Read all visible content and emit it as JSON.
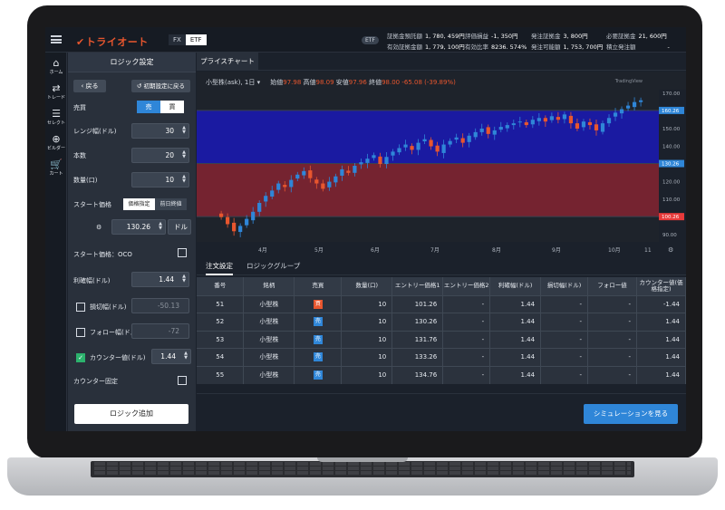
{
  "header": {
    "logo": "トライオート",
    "mode_tabs": [
      "FX",
      "ETF"
    ],
    "active_mode": "ETF",
    "etf_pill": "ETF",
    "account": [
      {
        "label": "証拠金預託額",
        "value": "1, 780, 459円"
      },
      {
        "label": "評価損益",
        "value": "-1, 350円"
      },
      {
        "label": "発注証拠金",
        "value": "3, 800円"
      },
      {
        "label": "必要証拠金",
        "value": "21, 600円"
      },
      {
        "label": "有効証拠金額",
        "value": "1, 779, 100円"
      },
      {
        "label": "有効比率",
        "value": "8236. 574%"
      },
      {
        "label": "発注可能額",
        "value": "1, 753, 700円"
      },
      {
        "label": "積立発注額",
        "value": "-"
      }
    ]
  },
  "nav": [
    {
      "icon": "home-icon",
      "label": "ホーム"
    },
    {
      "icon": "trade-icon",
      "label": "トレード"
    },
    {
      "icon": "select-icon",
      "label": "セレクト"
    },
    {
      "icon": "builder-icon",
      "label": "ビルダー"
    },
    {
      "icon": "cart-icon",
      "label": "カート"
    }
  ],
  "logic": {
    "title": "ロジック設定",
    "back": "戻る",
    "reset": "初期設定に戻る",
    "side_label": "売買",
    "side_options": [
      "売",
      "買"
    ],
    "range_label": "レンジ幅(ドル)",
    "range_value": "30",
    "count_label": "本数",
    "count_value": "20",
    "qty_label": "数量(口)",
    "qty_value": "10",
    "start_label": "スタート価格",
    "start_options": [
      "価格指定",
      "前日終値"
    ],
    "start_value": "130.26",
    "start_unit": "ドル",
    "oco_label": "スタート価格：OCO",
    "tp_label": "利確幅(ドル)",
    "tp_value": "1.44",
    "sl_label": "損切幅(ドル)",
    "sl_value": "-50.13",
    "follow_label": "フォロー幅(ドル)",
    "follow_value": "-72",
    "counter_label": "カウンター値(ドル)",
    "counter_value": "1.44",
    "counter_fixed_label": "カウンター固定",
    "add_button": "ロジック追加"
  },
  "chart_tab": "プライスチャート",
  "chart_info": {
    "symbol": "小型株(ask), 1日",
    "open_label": "始値",
    "open": "97.98",
    "high_label": "高値",
    "high": "98.09",
    "low_label": "安値",
    "low": "97.96",
    "close_label": "終値",
    "close": "98.00",
    "change": "-65.08 (-39.89%)",
    "watermark": "TradingView"
  },
  "chart_data": {
    "type": "candlestick",
    "x_ticks": [
      "4月",
      "5月",
      "6月",
      "7月",
      "8月",
      "9月",
      "10月",
      "11"
    ],
    "y_ticks": [
      170.0,
      160.0,
      150.0,
      140.0,
      130.0,
      120.0,
      110.0,
      100.0,
      90.0
    ],
    "ylim": [
      86,
      172
    ],
    "price_labels": [
      {
        "value": "160.26",
        "color": "#2f86d8"
      },
      {
        "value": "130.26",
        "color": "#2f86d8"
      },
      {
        "value": "100.26",
        "color": "#e83a3a"
      }
    ],
    "zones": [
      {
        "from": 130.26,
        "to": 160.26,
        "color": "#1a1aa8"
      },
      {
        "from": 100.26,
        "to": 130.26,
        "color": "#7a2430"
      }
    ],
    "close_series": [
      100,
      96,
      92,
      95,
      99,
      103,
      108,
      112,
      115,
      119,
      117,
      121,
      124,
      126,
      122,
      119,
      116,
      120,
      123,
      127,
      125,
      129,
      131,
      133,
      135,
      130,
      134,
      137,
      139,
      141,
      138,
      142,
      144,
      140,
      137,
      141,
      143,
      145,
      142,
      146,
      148,
      150,
      147,
      149,
      151,
      152,
      153,
      154,
      152,
      155,
      156,
      154,
      157,
      155,
      158,
      153,
      150,
      154,
      152,
      149,
      153,
      156,
      159,
      161,
      163,
      165,
      166
    ]
  },
  "orders": {
    "tabs": [
      "注文設定",
      "ロジックグループ"
    ],
    "columns": [
      "番号",
      "銘柄",
      "売買",
      "数量(口)",
      "エントリー価格1",
      "エントリー価格2",
      "利確幅(ドル)",
      "損切幅(ドル)",
      "フォロー値",
      "カウンター値(価格指定)"
    ],
    "rows": [
      {
        "no": "51",
        "name": "小型株",
        "side": "買",
        "qty": "10",
        "e1": "101.26",
        "e2": "-",
        "tp": "1.44",
        "sl": "-",
        "follow": "-",
        "counter": "-1.44"
      },
      {
        "no": "52",
        "name": "小型株",
        "side": "売",
        "qty": "10",
        "e1": "130.26",
        "e2": "-",
        "tp": "1.44",
        "sl": "-",
        "follow": "-",
        "counter": "1.44"
      },
      {
        "no": "53",
        "name": "小型株",
        "side": "売",
        "qty": "10",
        "e1": "131.76",
        "e2": "-",
        "tp": "1.44",
        "sl": "-",
        "follow": "-",
        "counter": "1.44"
      },
      {
        "no": "54",
        "name": "小型株",
        "side": "売",
        "qty": "10",
        "e1": "133.26",
        "e2": "-",
        "tp": "1.44",
        "sl": "-",
        "follow": "-",
        "counter": "1.44"
      },
      {
        "no": "55",
        "name": "小型株",
        "side": "売",
        "qty": "10",
        "e1": "134.76",
        "e2": "-",
        "tp": "1.44",
        "sl": "-",
        "follow": "-",
        "counter": "1.44"
      }
    ],
    "simulate_button": "シミュレーションを見る"
  }
}
